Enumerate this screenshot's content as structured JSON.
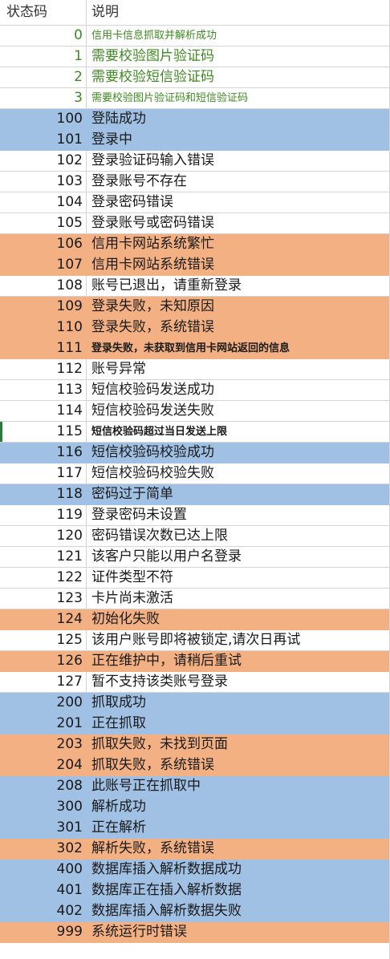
{
  "header": {
    "code": "状态码",
    "desc": "说明"
  },
  "rows": [
    {
      "code": "0",
      "desc": "信用卡信息抓取并解析成功",
      "bg": "white",
      "style": "green small"
    },
    {
      "code": "1",
      "desc": "需要校验图片验证码",
      "bg": "white",
      "style": "green"
    },
    {
      "code": "2",
      "desc": "需要校验短信验证码",
      "bg": "white",
      "style": "green"
    },
    {
      "code": "3",
      "desc": "需要校验图片验证码和短信验证码",
      "bg": "white",
      "style": "green small"
    },
    {
      "code": "100",
      "desc": "登陆成功",
      "bg": "blue",
      "style": ""
    },
    {
      "code": "101",
      "desc": "登录中",
      "bg": "blue",
      "style": ""
    },
    {
      "code": "102",
      "desc": "登录验证码输入错误",
      "bg": "white",
      "style": ""
    },
    {
      "code": "103",
      "desc": "登录账号不存在",
      "bg": "white",
      "style": ""
    },
    {
      "code": "104",
      "desc": "登录密码错误",
      "bg": "white",
      "style": ""
    },
    {
      "code": "105",
      "desc": "登录账号或密码错误",
      "bg": "white",
      "style": ""
    },
    {
      "code": "106",
      "desc": "信用卡网站系统繁忙",
      "bg": "orange",
      "style": ""
    },
    {
      "code": "107",
      "desc": "信用卡网站系统错误",
      "bg": "orange",
      "style": ""
    },
    {
      "code": "108",
      "desc": "账号已退出，请重新登录",
      "bg": "white",
      "style": ""
    },
    {
      "code": "109",
      "desc": "登录失败，未知原因",
      "bg": "orange",
      "style": ""
    },
    {
      "code": "110",
      "desc": "登录失败，系统错误",
      "bg": "orange",
      "style": ""
    },
    {
      "code": "111",
      "desc": "登录失败，未获取到信用卡网站返回的信息",
      "bg": "orange",
      "style": "small"
    },
    {
      "code": "112",
      "desc": "账号异常",
      "bg": "white",
      "style": ""
    },
    {
      "code": "113",
      "desc": "短信校验码发送成功",
      "bg": "white",
      "style": ""
    },
    {
      "code": "114",
      "desc": "短信校验码发送失败",
      "bg": "white",
      "style": ""
    },
    {
      "code": "115",
      "desc": "短信校验码超过当日发送上限",
      "bg": "white",
      "style": "small",
      "marker": true
    },
    {
      "code": "116",
      "desc": "短信校验码校验成功",
      "bg": "blue",
      "style": ""
    },
    {
      "code": "117",
      "desc": "短信校验码校验失败",
      "bg": "white",
      "style": ""
    },
    {
      "code": "118",
      "desc": "密码过于简单",
      "bg": "blue",
      "style": ""
    },
    {
      "code": "119",
      "desc": "登录密码未设置",
      "bg": "white",
      "style": ""
    },
    {
      "code": "120",
      "desc": "密码错误次数已达上限",
      "bg": "white",
      "style": ""
    },
    {
      "code": "121",
      "desc": "该客户只能以用户名登录",
      "bg": "white",
      "style": ""
    },
    {
      "code": "122",
      "desc": "证件类型不符",
      "bg": "white",
      "style": ""
    },
    {
      "code": "123",
      "desc": "卡片尚未激活",
      "bg": "white",
      "style": ""
    },
    {
      "code": "124",
      "desc": "初始化失败",
      "bg": "orange",
      "style": ""
    },
    {
      "code": "125",
      "desc": "该用户账号即将被锁定,请次日再试",
      "bg": "white",
      "style": ""
    },
    {
      "code": "126",
      "desc": "正在维护中，请稍后重试",
      "bg": "orange",
      "style": ""
    },
    {
      "code": "127",
      "desc": "暂不支持该类账号登录",
      "bg": "white",
      "style": ""
    },
    {
      "code": "200",
      "desc": "抓取成功",
      "bg": "blue",
      "style": ""
    },
    {
      "code": "201",
      "desc": "正在抓取",
      "bg": "blue",
      "style": ""
    },
    {
      "code": "203",
      "desc": "抓取失败，未找到页面",
      "bg": "orange",
      "style": ""
    },
    {
      "code": "204",
      "desc": "抓取失败，系统错误",
      "bg": "orange",
      "style": ""
    },
    {
      "code": "208",
      "desc": "此账号正在抓取中",
      "bg": "blue",
      "style": ""
    },
    {
      "code": "300",
      "desc": "解析成功",
      "bg": "blue",
      "style": ""
    },
    {
      "code": "301",
      "desc": "正在解析",
      "bg": "blue",
      "style": ""
    },
    {
      "code": "302",
      "desc": "解析失败，系统错误",
      "bg": "orange",
      "style": ""
    },
    {
      "code": "400",
      "desc": "数据库插入解析数据成功",
      "bg": "blue",
      "style": ""
    },
    {
      "code": "401",
      "desc": "数据库正在插入解析数据",
      "bg": "blue",
      "style": ""
    },
    {
      "code": "402",
      "desc": "数据库插入解析数据失败",
      "bg": "blue",
      "style": ""
    },
    {
      "code": "999",
      "desc": "系统运行时错误",
      "bg": "orange",
      "style": ""
    }
  ]
}
